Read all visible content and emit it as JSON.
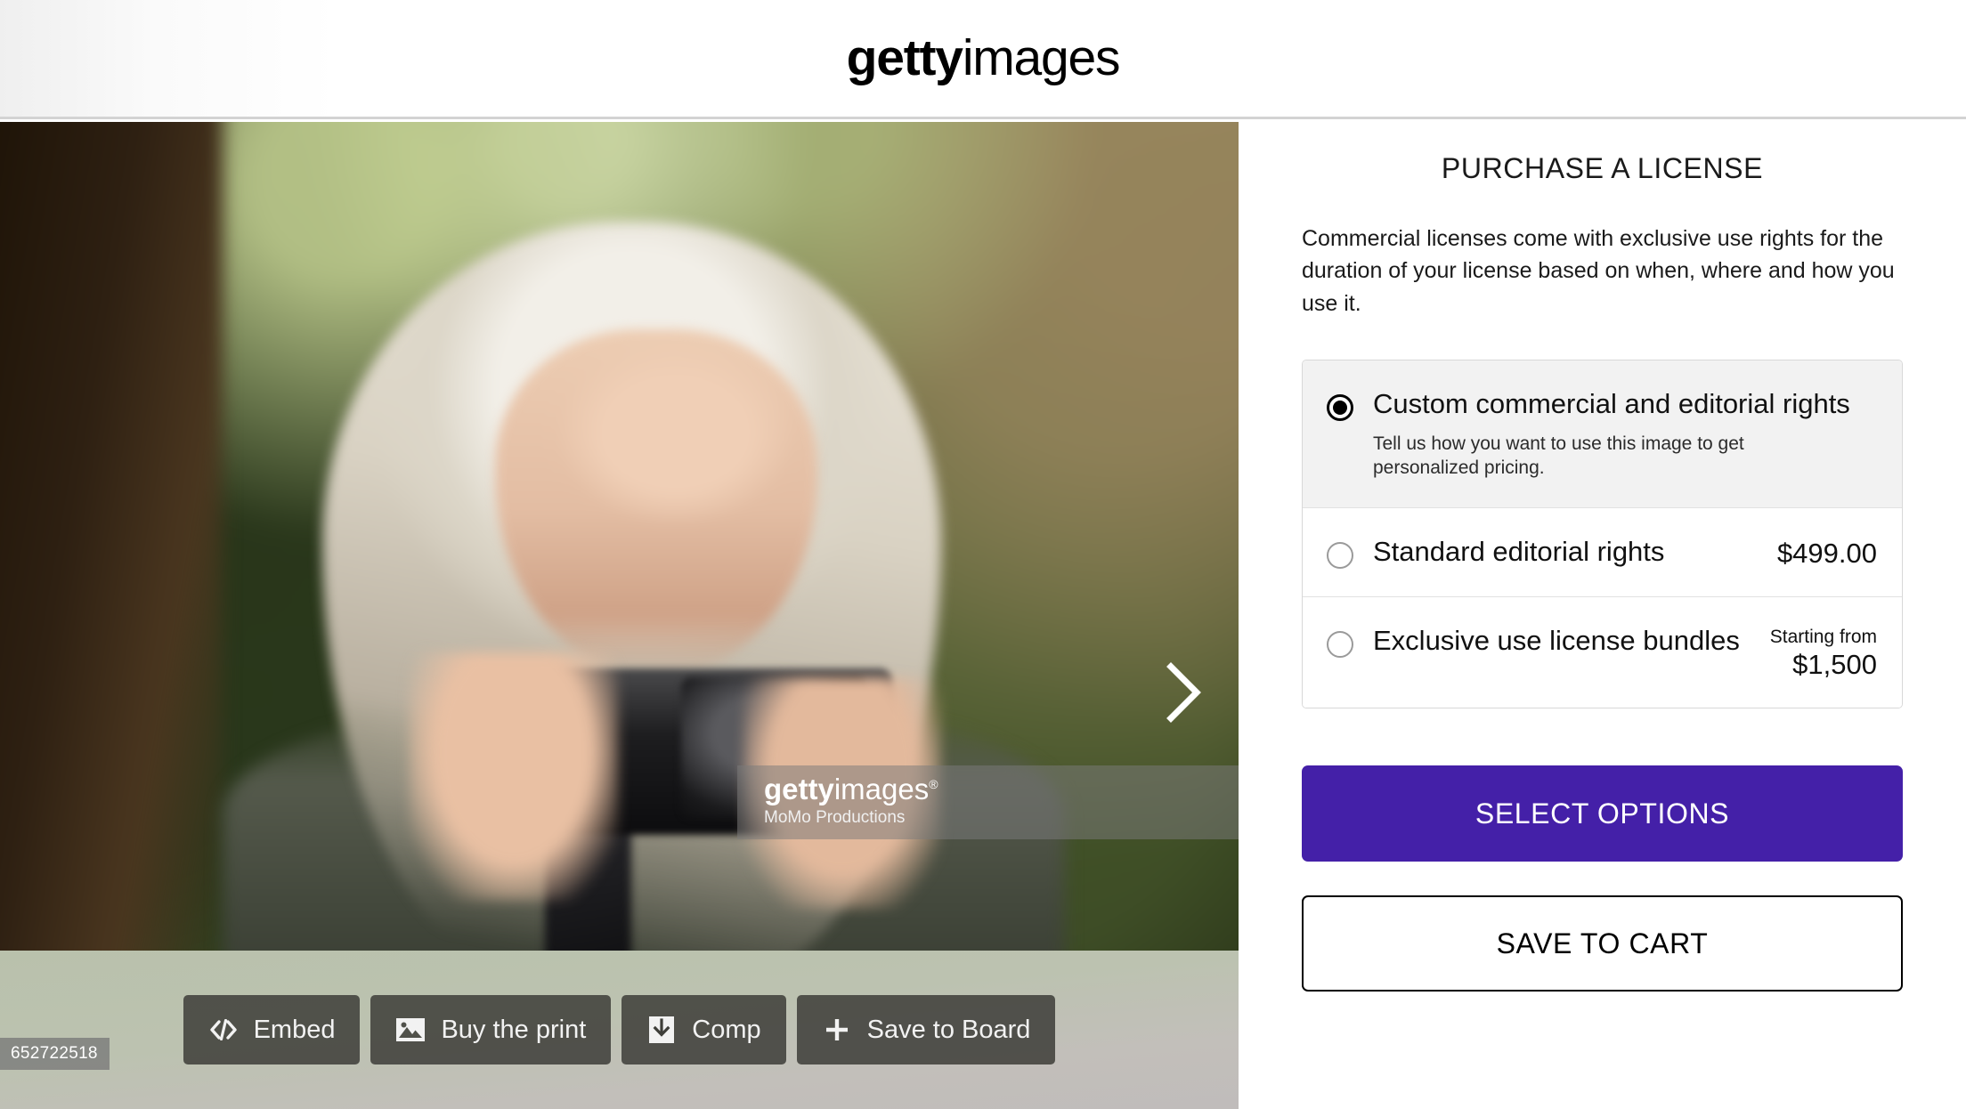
{
  "header": {
    "logo_bold": "getty",
    "logo_regular": "images"
  },
  "image": {
    "asset_id": "652722518",
    "next_arrow_icon": "chevron-right-icon",
    "watermark": {
      "logo_bold": "getty",
      "logo_regular": "images",
      "registered_mark": "®",
      "credit": "MoMo Productions"
    }
  },
  "toolbar": {
    "buttons": [
      {
        "label": "Embed",
        "icon": "code-icon"
      },
      {
        "label": "Buy the print",
        "icon": "image-icon"
      },
      {
        "label": "Comp",
        "icon": "download-icon"
      },
      {
        "label": "Save to Board",
        "icon": "plus-icon"
      }
    ]
  },
  "purchase": {
    "title": "PURCHASE A LICENSE",
    "description": "Commercial licenses come with exclusive use rights for the duration of your license based on when, where and how you use it.",
    "options": [
      {
        "label": "Custom commercial and editorial rights",
        "sublabel": "Tell us how you want to use this image to get personalized pricing.",
        "price_prefix": "",
        "price": "",
        "selected": true
      },
      {
        "label": "Standard editorial rights",
        "sublabel": "",
        "price_prefix": "",
        "price": "$499.00",
        "selected": false
      },
      {
        "label": "Exclusive use license bundles",
        "sublabel": "",
        "price_prefix": "Starting from",
        "price": "$1,500",
        "selected": false
      }
    ],
    "primary_button": "SELECT OPTIONS",
    "secondary_button": "SAVE TO CART"
  },
  "colors": {
    "accent_purple": "#4420a8",
    "selected_option_bg": "#f2f2f2",
    "toolbar_button_bg": "#3e3e39"
  }
}
